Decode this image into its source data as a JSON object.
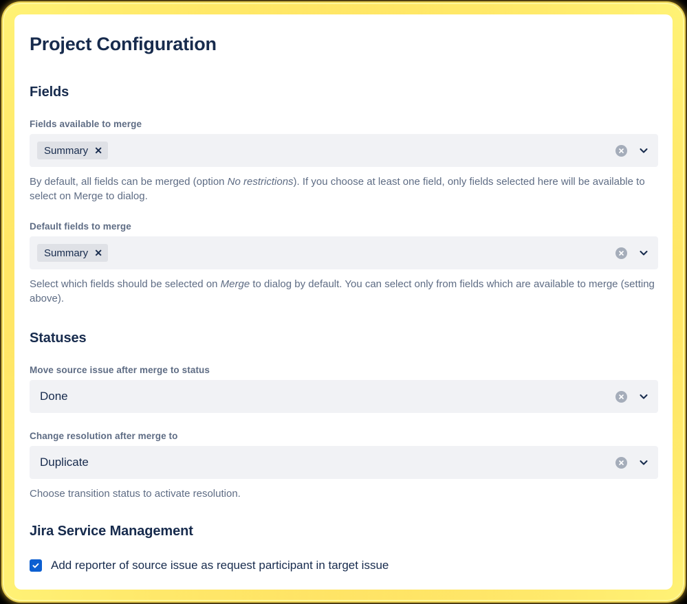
{
  "window": {
    "frame_color": "#ffc73c",
    "card_background": "#ffffff",
    "backdrop_color": "#000000"
  },
  "page": {
    "title": "Project Configuration"
  },
  "sections": {
    "fields": {
      "heading": "Fields",
      "available": {
        "label": "Fields available to merge",
        "tags": [
          "Summary"
        ],
        "tag_remove_glyph": "✕",
        "clear_icon": "clear-circle-icon",
        "dropdown_icon": "chevron-down-icon",
        "helper_prefix": "By default, all fields can be merged (option ",
        "helper_italic": "No restrictions",
        "helper_suffix": "). If you choose at least one field, only fields selected here will be available to select on Merge to dialog."
      },
      "defaults": {
        "label": "Default fields to merge",
        "tags": [
          "Summary"
        ],
        "tag_remove_glyph": "✕",
        "clear_icon": "clear-circle-icon",
        "dropdown_icon": "chevron-down-icon",
        "helper_prefix": "Select which fields should be selected on ",
        "helper_italic": "Merge",
        "helper_suffix": " to dialog by default. You can select only from fields which are available to merge (setting above)."
      }
    },
    "statuses": {
      "heading": "Statuses",
      "move_status": {
        "label": "Move source issue after merge to status",
        "value": "Done",
        "clear_icon": "clear-circle-icon",
        "dropdown_icon": "chevron-down-icon"
      },
      "resolution": {
        "label": "Change resolution after merge to",
        "value": "Duplicate",
        "clear_icon": "clear-circle-icon",
        "dropdown_icon": "chevron-down-icon",
        "helper": "Choose transition status to activate resolution."
      }
    },
    "jsm": {
      "heading": "Jira Service Management",
      "checkbox": {
        "label": "Add reporter of source issue as request participant in target issue",
        "checked": true,
        "accent_color": "#0c5fd1"
      }
    }
  }
}
